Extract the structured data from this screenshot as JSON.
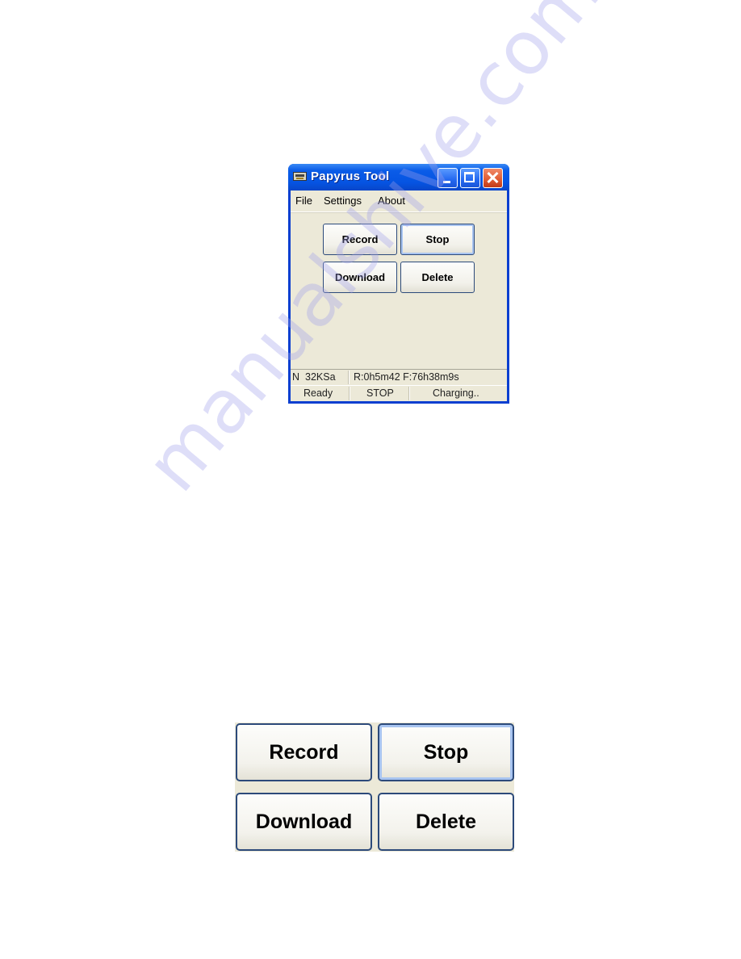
{
  "window": {
    "title": "Papyrus Tool",
    "app_icon": "cassette-recorder-icon",
    "controls": {
      "minimize": "minimize-icon",
      "maximize": "maximize-icon",
      "close": "close-icon",
      "close_glyph": "✕"
    }
  },
  "menu": {
    "items": [
      {
        "label": "File"
      },
      {
        "label": "Settings"
      },
      {
        "label": "About"
      }
    ]
  },
  "buttons": {
    "record": "Record",
    "stop": "Stop",
    "download": "Download",
    "delete": "Delete"
  },
  "status_bar": {
    "row1": {
      "mode": "N",
      "sample_rate": "32KSa",
      "times": "R:0h5m42 F:76h38m9s"
    },
    "row2": {
      "state": "Ready",
      "recorder": "STOP",
      "power": "Charging.."
    }
  },
  "enlarged_buttons": {
    "record": "Record",
    "stop": "Stop",
    "download": "Download",
    "delete": "Delete"
  },
  "watermark": "manualshive.com",
  "colors": {
    "titlebar_blue": "#0554e2",
    "client_bg": "#ece9d8",
    "close_red": "#e05a30",
    "button_border": "#2c4a7a"
  }
}
